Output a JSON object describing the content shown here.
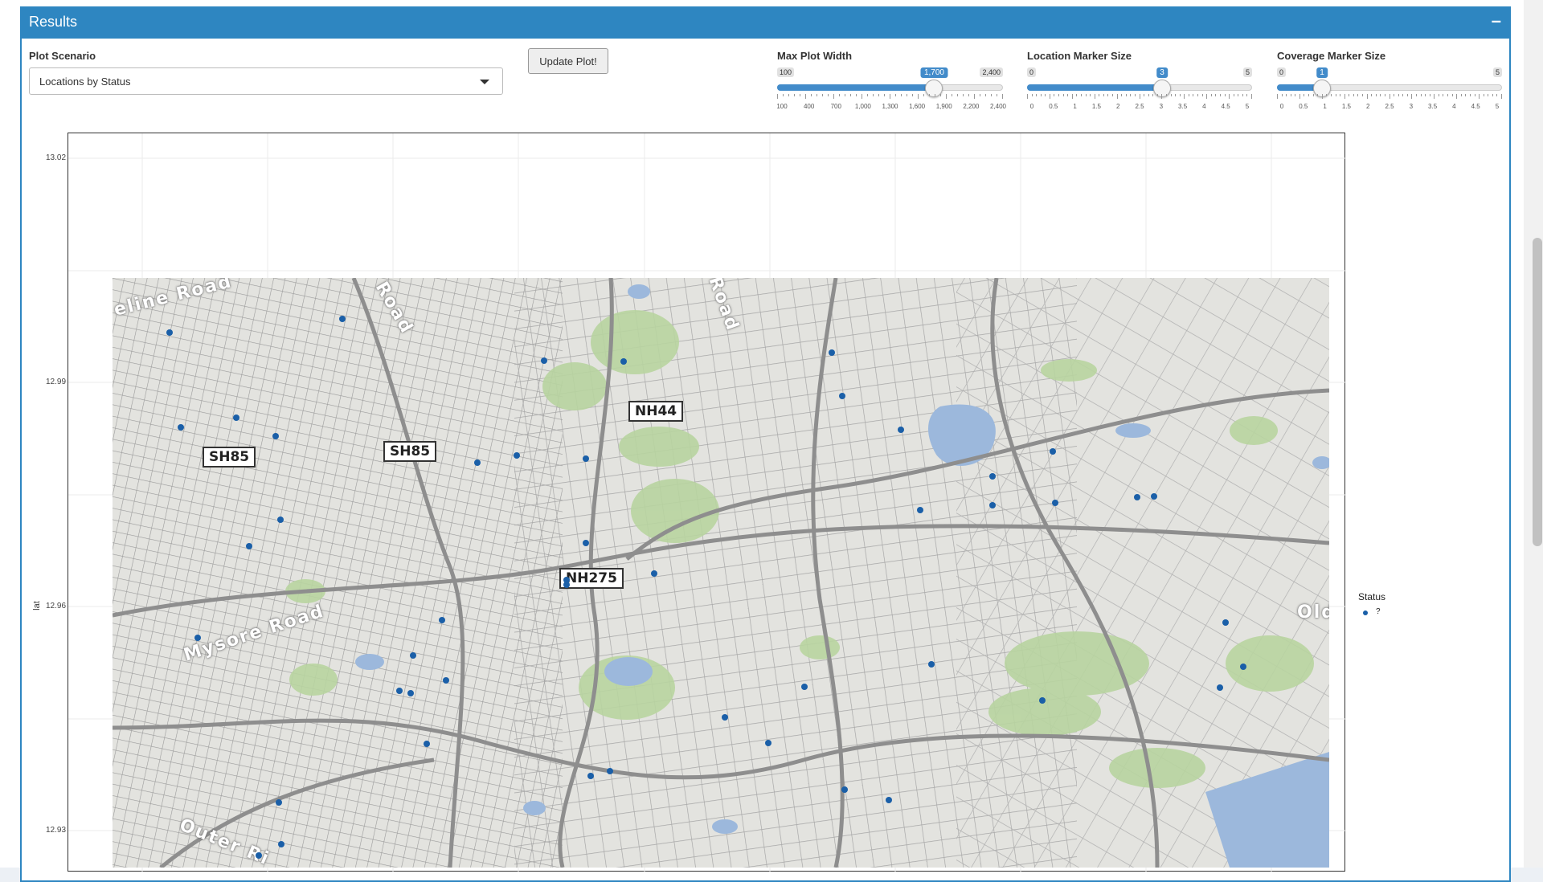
{
  "panel": {
    "title": "Results",
    "collapse_icon": "minus-icon"
  },
  "controls": {
    "scenario_label": "Plot Scenario",
    "scenario_value": "Locations by Status",
    "update_button": "Update Plot!",
    "sliders": [
      {
        "label": "Max Plot Width",
        "min": "100",
        "max": "2,400",
        "value": "1,700",
        "fraction": 0.6957,
        "ticks": [
          "100",
          "400",
          "700",
          "1,000",
          "1,300",
          "1,600",
          "1,900",
          "2,200",
          "2,400"
        ]
      },
      {
        "label": "Location Marker Size",
        "min": "0",
        "max": "5",
        "value": "3",
        "fraction": 0.6,
        "ticks": [
          "0",
          "0.5",
          "1",
          "1.5",
          "2",
          "2.5",
          "3",
          "3.5",
          "4",
          "4.5",
          "5"
        ]
      },
      {
        "label": "Coverage Marker Size",
        "min": "0",
        "max": "5",
        "value": "1",
        "fraction": 0.2,
        "ticks": [
          "0",
          "0.5",
          "1",
          "1.5",
          "2",
          "2.5",
          "3",
          "3.5",
          "4",
          "4.5",
          "5"
        ]
      }
    ]
  },
  "plot": {
    "y_label": "lat",
    "y_ticks": [
      "13.02",
      "12.99",
      "12.96",
      "12.93"
    ],
    "legend_title": "Status",
    "legend_label": "?",
    "marker_color": "#1a5fa8",
    "map_labels": {
      "roads": [
        "SH85",
        "SH85",
        "NH44",
        "NH275"
      ],
      "names": [
        "eline Road",
        "Road",
        "Mysore Road",
        "Road",
        "Outer Ri",
        "Old"
      ]
    },
    "locations": [
      {
        "lon": 0.047,
        "lat": 0.093
      },
      {
        "lon": 0.189,
        "lat": 0.07
      },
      {
        "lon": 0.355,
        "lat": 0.14
      },
      {
        "lon": 0.42,
        "lat": 0.142
      },
      {
        "lon": 0.591,
        "lat": 0.127
      },
      {
        "lon": 0.6,
        "lat": 0.2
      },
      {
        "lon": 0.056,
        "lat": 0.254
      },
      {
        "lon": 0.102,
        "lat": 0.237
      },
      {
        "lon": 0.134,
        "lat": 0.268
      },
      {
        "lon": 0.3,
        "lat": 0.313
      },
      {
        "lon": 0.332,
        "lat": 0.301
      },
      {
        "lon": 0.389,
        "lat": 0.307
      },
      {
        "lon": 0.648,
        "lat": 0.258
      },
      {
        "lon": 0.723,
        "lat": 0.336
      },
      {
        "lon": 0.773,
        "lat": 0.294
      },
      {
        "lon": 0.138,
        "lat": 0.41
      },
      {
        "lon": 0.112,
        "lat": 0.455
      },
      {
        "lon": 0.389,
        "lat": 0.45
      },
      {
        "lon": 0.445,
        "lat": 0.502
      },
      {
        "lon": 0.373,
        "lat": 0.512
      },
      {
        "lon": 0.664,
        "lat": 0.394
      },
      {
        "lon": 0.723,
        "lat": 0.385
      },
      {
        "lon": 0.775,
        "lat": 0.382
      },
      {
        "lon": 0.842,
        "lat": 0.372
      },
      {
        "lon": 0.856,
        "lat": 0.37
      },
      {
        "lon": 0.07,
        "lat": 0.61
      },
      {
        "lon": 0.271,
        "lat": 0.58
      },
      {
        "lon": 0.247,
        "lat": 0.64
      },
      {
        "lon": 0.274,
        "lat": 0.683
      },
      {
        "lon": 0.236,
        "lat": 0.7
      },
      {
        "lon": 0.245,
        "lat": 0.705
      },
      {
        "lon": 0.258,
        "lat": 0.79
      },
      {
        "lon": 0.503,
        "lat": 0.745
      },
      {
        "lon": 0.569,
        "lat": 0.693
      },
      {
        "lon": 0.673,
        "lat": 0.655
      },
      {
        "lon": 0.764,
        "lat": 0.717
      },
      {
        "lon": 0.915,
        "lat": 0.585
      },
      {
        "lon": 0.929,
        "lat": 0.66
      },
      {
        "lon": 0.91,
        "lat": 0.695
      },
      {
        "lon": 0.539,
        "lat": 0.789
      },
      {
        "lon": 0.393,
        "lat": 0.845
      },
      {
        "lon": 0.409,
        "lat": 0.837
      },
      {
        "lon": 0.602,
        "lat": 0.868
      },
      {
        "lon": 0.638,
        "lat": 0.885
      },
      {
        "lon": 0.137,
        "lat": 0.89
      },
      {
        "lon": 0.139,
        "lat": 0.96
      },
      {
        "lon": 0.12,
        "lat": 0.98
      },
      {
        "lon": 0.373,
        "lat": 0.52
      }
    ]
  }
}
